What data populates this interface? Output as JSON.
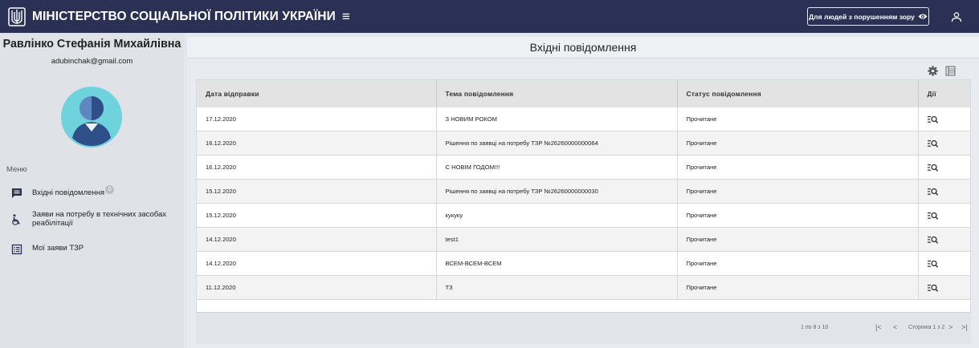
{
  "header": {
    "title": "МІНІСТЕРСТВО СОЦІАЛЬНОЇ ПОЛІТИКИ УКРАЇНИ",
    "menu_icon": "hamburger-icon",
    "vision_button_label": "Для людей з порушенням зору",
    "vision_icon": "eye-icon",
    "user_icon": "user-icon",
    "colors": {
      "bar": "#2b3154"
    }
  },
  "profile": {
    "name": "Равлінко Стефанія Михайлівна",
    "email": "adubinchak@gmail.com"
  },
  "sidebar": {
    "menu_caption": "Меню",
    "items": [
      {
        "label": "Вхідні повідомлення",
        "icon": "message-icon",
        "badge": "0"
      },
      {
        "label": "Заяви на потребу в технічних засобах реабілітації",
        "icon": "wheelchair-icon"
      },
      {
        "label": "Мої заяви ТЗР",
        "icon": "list-icon"
      }
    ]
  },
  "main": {
    "title": "Вхідні повідомлення",
    "toolbar": {
      "settings_icon": "gear-icon",
      "columns_icon": "columns-icon"
    },
    "table": {
      "columns": [
        "Дата відправки",
        "Тема повідомлення",
        "Статус повідомлення",
        "Дії"
      ],
      "rows": [
        {
          "date": "17.12.2020",
          "subject": "З НОВИМ РОКОМ",
          "status": "Прочитане"
        },
        {
          "date": "16.12.2020",
          "subject": "Рішення по заявці на потребу ТЗР №26260000000064",
          "status": "Прочитане"
        },
        {
          "date": "16.12.2020",
          "subject": "С НОВІМ ГОДОМ!!!",
          "status": "Прочитане"
        },
        {
          "date": "15.12.2020",
          "subject": "Рішення по заявці на потребу ТЗР №26260000000030",
          "status": "Прочитане"
        },
        {
          "date": "15.12.2020",
          "subject": "кукуку",
          "status": "Прочитане"
        },
        {
          "date": "14.12.2020",
          "subject": "test1",
          "status": "Прочитане"
        },
        {
          "date": "14.12.2020",
          "subject": "ВСЕМ-ВСЕМ-ВСЕМ",
          "status": "Прочитане"
        },
        {
          "date": "11.12.2020",
          "subject": "ТЗ",
          "status": "Прочитане"
        }
      ],
      "action_icon": "view-details-icon"
    },
    "pagination": {
      "range": "1 по 8 з 10",
      "first": "|<",
      "prev": "<",
      "page": "Сторінка 1 з 2",
      "next": ">",
      "last": ">|"
    }
  }
}
